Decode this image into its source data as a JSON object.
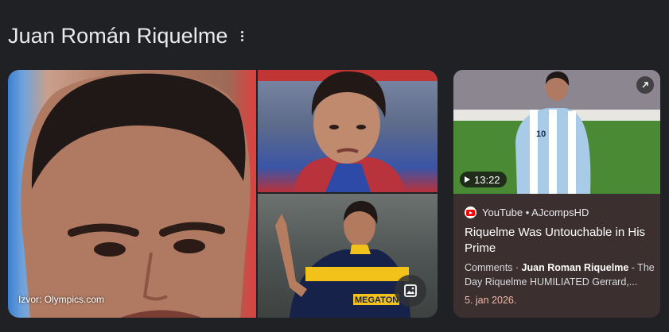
{
  "header": {
    "title": "Juan Román Riquelme",
    "more_icon": "more-vert-icon"
  },
  "images": {
    "main_credit": "Izvor: Olympics.com",
    "image_search_icon": "image-icon"
  },
  "video": {
    "duration": "13:22",
    "source": "YouTube",
    "separator": " • ",
    "channel": "AJcompsHD",
    "title": "Riquelme Was Untouchable in His Prime",
    "snippet_prefix": "Comments · ",
    "snippet_bold": "Juan Roman Riquelme",
    "snippet_suffix": " - The Day Riquelme HUMILIATED Gerrard,...",
    "date": "5. jan 2026.",
    "accent": "#f2b8a3",
    "card_bg": "#3b2f30"
  },
  "colors": {
    "background": "#202124",
    "text": "#e8eaed"
  }
}
